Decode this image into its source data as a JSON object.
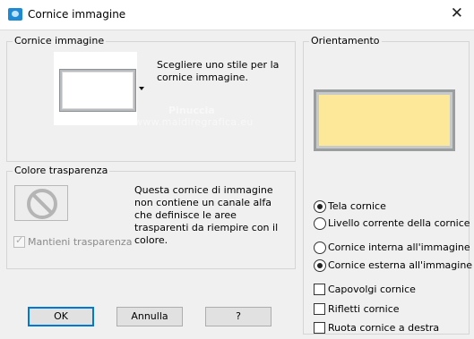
{
  "window": {
    "title": "Cornice immagine",
    "close_glyph": "✕"
  },
  "frame_group": {
    "label": "Cornice immagine",
    "description": "Scegliere uno stile per la cornice immagine."
  },
  "transparency_group": {
    "label": "Colore trasparenza",
    "description": "Questa cornice di immagine non contiene un canale alfa che definisce le aree trasparenti da riempire con il colore.",
    "keep_transparency_label": "Mantieni trasparenza",
    "keep_transparency_checked": true,
    "keep_transparency_enabled": false
  },
  "orientation_group": {
    "label": "Orientamento",
    "preview_color": "#fde89a",
    "canvas_options": [
      {
        "label": "Tela cornice",
        "checked": true
      },
      {
        "label": "Livello corrente della cornice",
        "checked": false
      }
    ],
    "placement_options": [
      {
        "label": "Cornice interna all'immagine",
        "checked": false
      },
      {
        "label": "Cornice esterna all'immagine",
        "checked": true
      }
    ],
    "checkboxes": [
      {
        "label": "Capovolgi cornice",
        "checked": false
      },
      {
        "label": "Rifletti cornice",
        "checked": false
      },
      {
        "label": "Ruota cornice a destra",
        "checked": false
      }
    ]
  },
  "buttons": {
    "ok": "OK",
    "cancel": "Annulla",
    "help": "?"
  },
  "watermark": {
    "line1": "Pinuccia",
    "line2": "www.maidiregrafica.eu"
  },
  "colors": {
    "dialog_bg": "#f0f0f0",
    "accent": "#0078d7",
    "app_icon": "#1e8ad6"
  }
}
